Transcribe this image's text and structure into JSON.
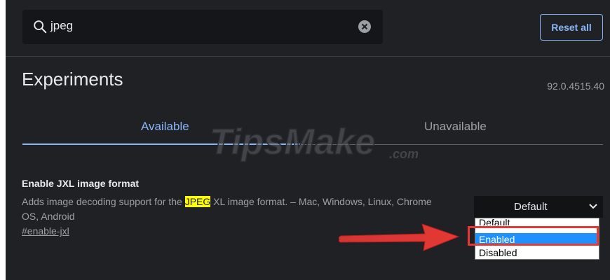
{
  "header": {
    "search": {
      "value": "jpeg"
    },
    "reset_label": "Reset all"
  },
  "page": {
    "title": "Experiments",
    "version": "92.0.4515.40"
  },
  "tabs": [
    {
      "label": "Available",
      "active": true
    },
    {
      "label": "Unavailable",
      "active": false
    }
  ],
  "watermark": {
    "text": "TipsMake",
    "suffix": ".com"
  },
  "experiment": {
    "title": "Enable JXL image format",
    "desc_prefix": "Adds image decoding support for the ",
    "desc_highlight": "JPEG",
    "desc_suffix": " XL image format. – Mac, Windows, Linux, Chrome OS, Android",
    "link": "#enable-jxl",
    "select_value": "Default",
    "options": [
      "Default",
      "Enabled",
      "Disabled"
    ],
    "highlighted_option": "Enabled"
  },
  "colors": {
    "background": "#202124",
    "accent": "#8ab4f8",
    "highlight": "#ffff00",
    "selected_option": "#1e90ff",
    "annotation": "#e53935"
  }
}
